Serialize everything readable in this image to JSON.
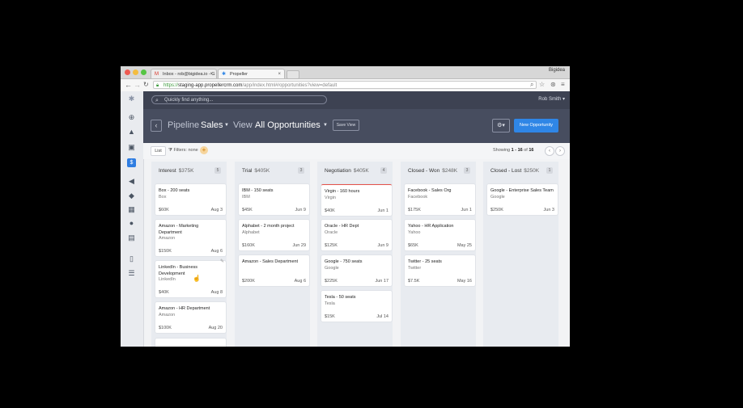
{
  "browser": {
    "tabs": [
      {
        "label": "Inbox - rob@bigidea.io - G",
        "icon": "gmail-icon"
      },
      {
        "label": "Propeller",
        "icon": "propeller-logo-icon"
      }
    ],
    "profile": "Bigidea",
    "url": {
      "scheme": "https://",
      "host": "staging-app.propellercrm.com",
      "path": "/app/index.html#/opportunities?view=default"
    }
  },
  "app": {
    "search_placeholder": "Quickly find anything...",
    "user": "Rob Smith ▾",
    "pipeline_label": "Pipeline",
    "pipeline_value": "Sales",
    "view_label": "View",
    "view_value": "All Opportunities",
    "save_view": "Save View",
    "new_opportunity": "New Opportunity",
    "list_button": "List",
    "filters": "Filters: none",
    "showing": {
      "prefix": "Showing",
      "range": "1 - 16",
      "of": "of",
      "total": "16"
    }
  },
  "columns": [
    {
      "name": "Interest",
      "amount": "$375K",
      "count": "5",
      "cards": [
        {
          "title": "Box - 200 seats",
          "company": "Box",
          "amount": "$60K",
          "date": "Aug 3"
        },
        {
          "title": "Amazon - Marketing Department",
          "company": "Amazon",
          "amount": "$150K",
          "date": "Aug 6"
        },
        {
          "title": "LinkedIn - Business Development",
          "company": "LinkedIn",
          "amount": "$40K",
          "date": "Aug 8"
        },
        {
          "title": "Amazon - HR Department",
          "company": "Amazon",
          "amount": "$100K",
          "date": "Aug 20"
        }
      ]
    },
    {
      "name": "Trial",
      "amount": "$405K",
      "count": "3",
      "cards": [
        {
          "title": "IBM - 150 seats",
          "company": "IBM",
          "amount": "$45K",
          "date": "Jun 9"
        },
        {
          "title": "Alphabet - 2 month project",
          "company": "Alphabet",
          "amount": "$160K",
          "date": "Jun 29"
        },
        {
          "title": "Amazon - Sales Department",
          "company": "",
          "amount": "$200K",
          "date": "Aug 6"
        }
      ]
    },
    {
      "name": "Negotiation",
      "amount": "$405K",
      "count": "4",
      "cards": [
        {
          "title": "Virgin - 160 hours",
          "company": "Virgin",
          "amount": "$40K",
          "date": "Jun 1"
        },
        {
          "title": "Oracle - HR Dept",
          "company": "Oracle",
          "amount": "$125K",
          "date": "Jun 9"
        },
        {
          "title": "Google - 750 seats",
          "company": "Google",
          "amount": "$225K",
          "date": "Jun 17"
        },
        {
          "title": "Tesla - 50 seats",
          "company": "Tesla",
          "amount": "$15K",
          "date": "Jul 14"
        }
      ]
    },
    {
      "name": "Closed - Won",
      "amount": "$248K",
      "count": "3",
      "cards": [
        {
          "title": "Facebook - Sales Org",
          "company": "Facebook",
          "amount": "$175K",
          "date": "Jun 1"
        },
        {
          "title": "Yahoo - HR Application",
          "company": "Yahoo",
          "amount": "$65K",
          "date": "May 25"
        },
        {
          "title": "Twitter - 25 seats",
          "company": "Twitter",
          "amount": "$7.5K",
          "date": "May 16"
        }
      ]
    },
    {
      "name": "Closed - Lost",
      "amount": "$250K",
      "count": "1",
      "cards": [
        {
          "title": "Google - Enterprise Sales Team",
          "company": "Google",
          "amount": "$250K",
          "date": "Jun 3"
        }
      ]
    }
  ],
  "colors": {
    "accent": "#2f86e6",
    "header": "#3d4252",
    "pipeline_header": "#474d5f",
    "negotiation_highlight": "#e5534b"
  }
}
